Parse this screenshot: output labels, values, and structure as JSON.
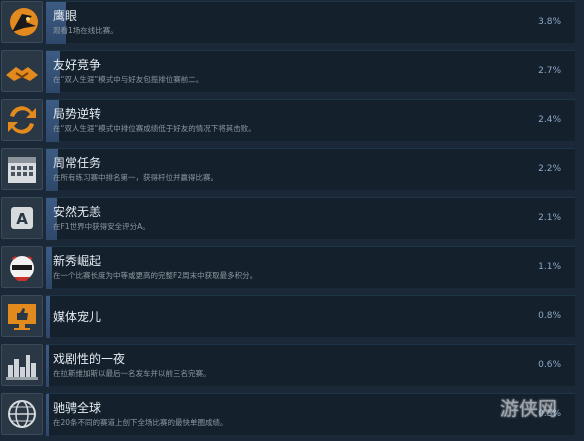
{
  "achievements": [
    {
      "title": "鹰眼",
      "description": "观看1场在线比赛。",
      "percent": "3.8%",
      "progress": 3.8,
      "icon": "eagle-icon"
    },
    {
      "title": "友好竞争",
      "description": "在“双人生涯”模式中与好友包揽排位赛前二。",
      "percent": "2.7%",
      "progress": 2.7,
      "icon": "handshake-icon"
    },
    {
      "title": "局势逆转",
      "description": "在“双人生涯”模式中排位赛成绩低于好友的情况下将其击败。",
      "percent": "2.4%",
      "progress": 2.4,
      "icon": "swap-arrows-icon"
    },
    {
      "title": "周常任务",
      "description": "在所有练习赛中排名第一，获得杆位并赢得比赛。",
      "percent": "2.2%",
      "progress": 2.2,
      "icon": "calendar-icon"
    },
    {
      "title": "安然无恙",
      "description": "在F1世界中获得安全评分A。",
      "percent": "2.1%",
      "progress": 2.1,
      "icon": "grade-a-icon"
    },
    {
      "title": "新秀崛起",
      "description": "在一个比赛长度为中等或更高的完整F2周末中获取最多积分。",
      "percent": "1.1%",
      "progress": 1.1,
      "icon": "helmet-icon"
    },
    {
      "title": "媒体宠儿",
      "description": "",
      "percent": "0.8%",
      "progress": 0.8,
      "icon": "monitor-thumbs-up-icon"
    },
    {
      "title": "戏剧性的一夜",
      "description": "在拉斯维加斯以最后一名发车并以前三名完赛。",
      "percent": "0.6%",
      "progress": 0.6,
      "icon": "city-skyline-icon"
    },
    {
      "title": "驰骋全球",
      "description": "在20条不同的赛道上创下全场比赛的最快单圈成绩。",
      "percent": "0.5%",
      "progress": 0.5,
      "icon": "globe-icon"
    }
  ],
  "watermark": "游侠网"
}
